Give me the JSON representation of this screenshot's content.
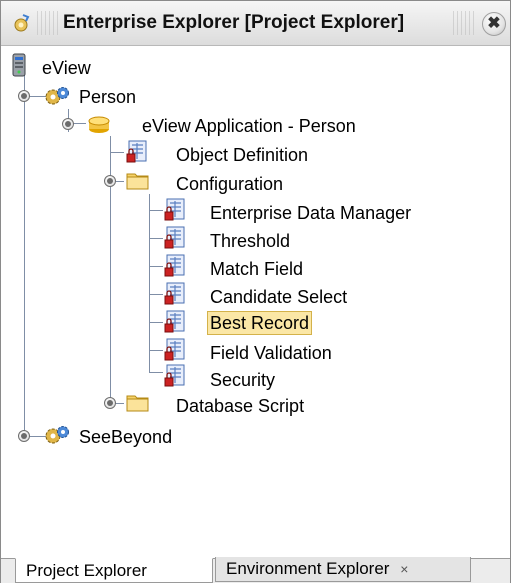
{
  "window": {
    "title": "Enterprise Explorer [Project Explorer]",
    "close_glyph": "✖"
  },
  "tree": {
    "root": "eView",
    "person": "Person",
    "application": "eView Application - Person",
    "object_definition": "Object Definition",
    "configuration": "Configuration",
    "config_items": [
      "Enterprise Data Manager",
      "Threshold",
      "Match Field",
      "Candidate Select",
      "Best Record",
      "Field Validation",
      "Security"
    ],
    "database_script": "Database Script",
    "seebeyond": "SeeBeyond",
    "selected": "Best Record"
  },
  "tabs": {
    "active": "Project Explorer",
    "inactive": "Environment Explorer",
    "close_glyph": "×"
  },
  "colors": {
    "selection_bg": "#fbe7a6",
    "tree_lines": "#7f8ea6",
    "folder": "#f3c545",
    "element_icon": "#5a7fc0",
    "element_lock": "#cc2222"
  },
  "icons": {
    "window": "enterprise-explorer-icon",
    "root": "server-icon",
    "project": "gears-project-icon",
    "application": "database-disk-icon",
    "folder": "folder-icon",
    "element": "locked-document-icon"
  }
}
